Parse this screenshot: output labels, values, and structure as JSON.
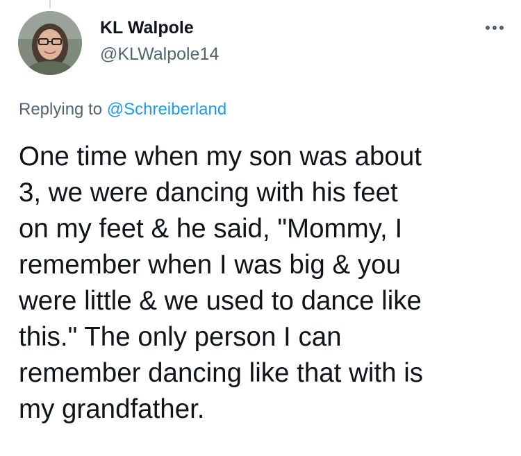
{
  "author": {
    "display_name": "KL Walpole",
    "handle": "@KLWalpole14"
  },
  "reply_context": {
    "prefix": "Replying to",
    "mention": "@Schreiberland"
  },
  "tweet": {
    "lines": [
      "One time when my son was about",
      "3, we were dancing with his feet",
      "on my feet & he said, \"Mommy, I",
      "remember when I was big & you",
      "were little & we used to dance like",
      "this.\" The only person I can",
      "remember dancing like that with is",
      "my grandfather."
    ]
  },
  "icons": {
    "more": "more-horizontal-icon"
  },
  "colors": {
    "text_primary": "#0f1419",
    "text_secondary": "#536471",
    "link": "#1d9bf0"
  }
}
